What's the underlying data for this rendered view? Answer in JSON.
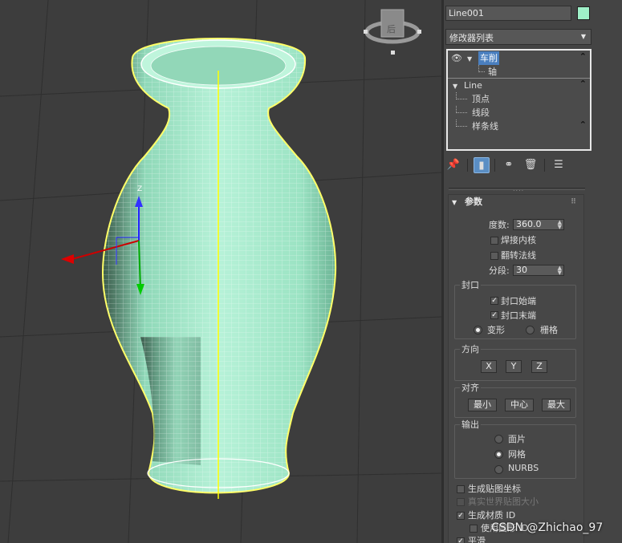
{
  "viewport": {
    "viewcube_label": "后",
    "axes": {
      "x": "",
      "y": "",
      "z": "Z"
    }
  },
  "panel": {
    "object_name": "Line001",
    "object_color": "#9ff0c8",
    "modifier_list": "修改器列表",
    "stack": [
      {
        "label": "车削",
        "selected": true
      },
      {
        "label": "轴",
        "child": true
      },
      {
        "label": "Line"
      },
      {
        "label": "顶点",
        "child": true
      },
      {
        "label": "线段",
        "child": true
      },
      {
        "label": "样条线",
        "child": true
      }
    ],
    "toolbar": [
      "pin-stack",
      "show-end-result",
      "make-unique",
      "remove-modifier",
      "configure-modifier-sets"
    ],
    "params": {
      "title": "参数",
      "degrees_label": "度数:",
      "degrees_value": "360.0",
      "weld_core": "焊接内核",
      "flip_normals": "翻转法线",
      "segments_label": "分段:",
      "segments_value": "30",
      "capping": {
        "title": "封口",
        "cap_start": "封口始端",
        "cap_end": "封口末端",
        "morph": "变形",
        "grid": "栅格"
      },
      "direction": {
        "title": "方向",
        "x": "X",
        "y": "Y",
        "z": "Z"
      },
      "align": {
        "title": "对齐",
        "min": "最小",
        "center": "中心",
        "max": "最大"
      },
      "output": {
        "title": "输出",
        "patch": "面片",
        "mesh": "网格",
        "nurbs": "NURBS"
      },
      "gen_map_coords": "生成贴图坐标",
      "real_world_map": "真实世界贴图大小",
      "gen_material_ids": "生成材质 ID",
      "use_shape_ids": "使用图形 ID",
      "smooth": "平滑"
    }
  },
  "watermark": "CSDN @Zhichao_97"
}
